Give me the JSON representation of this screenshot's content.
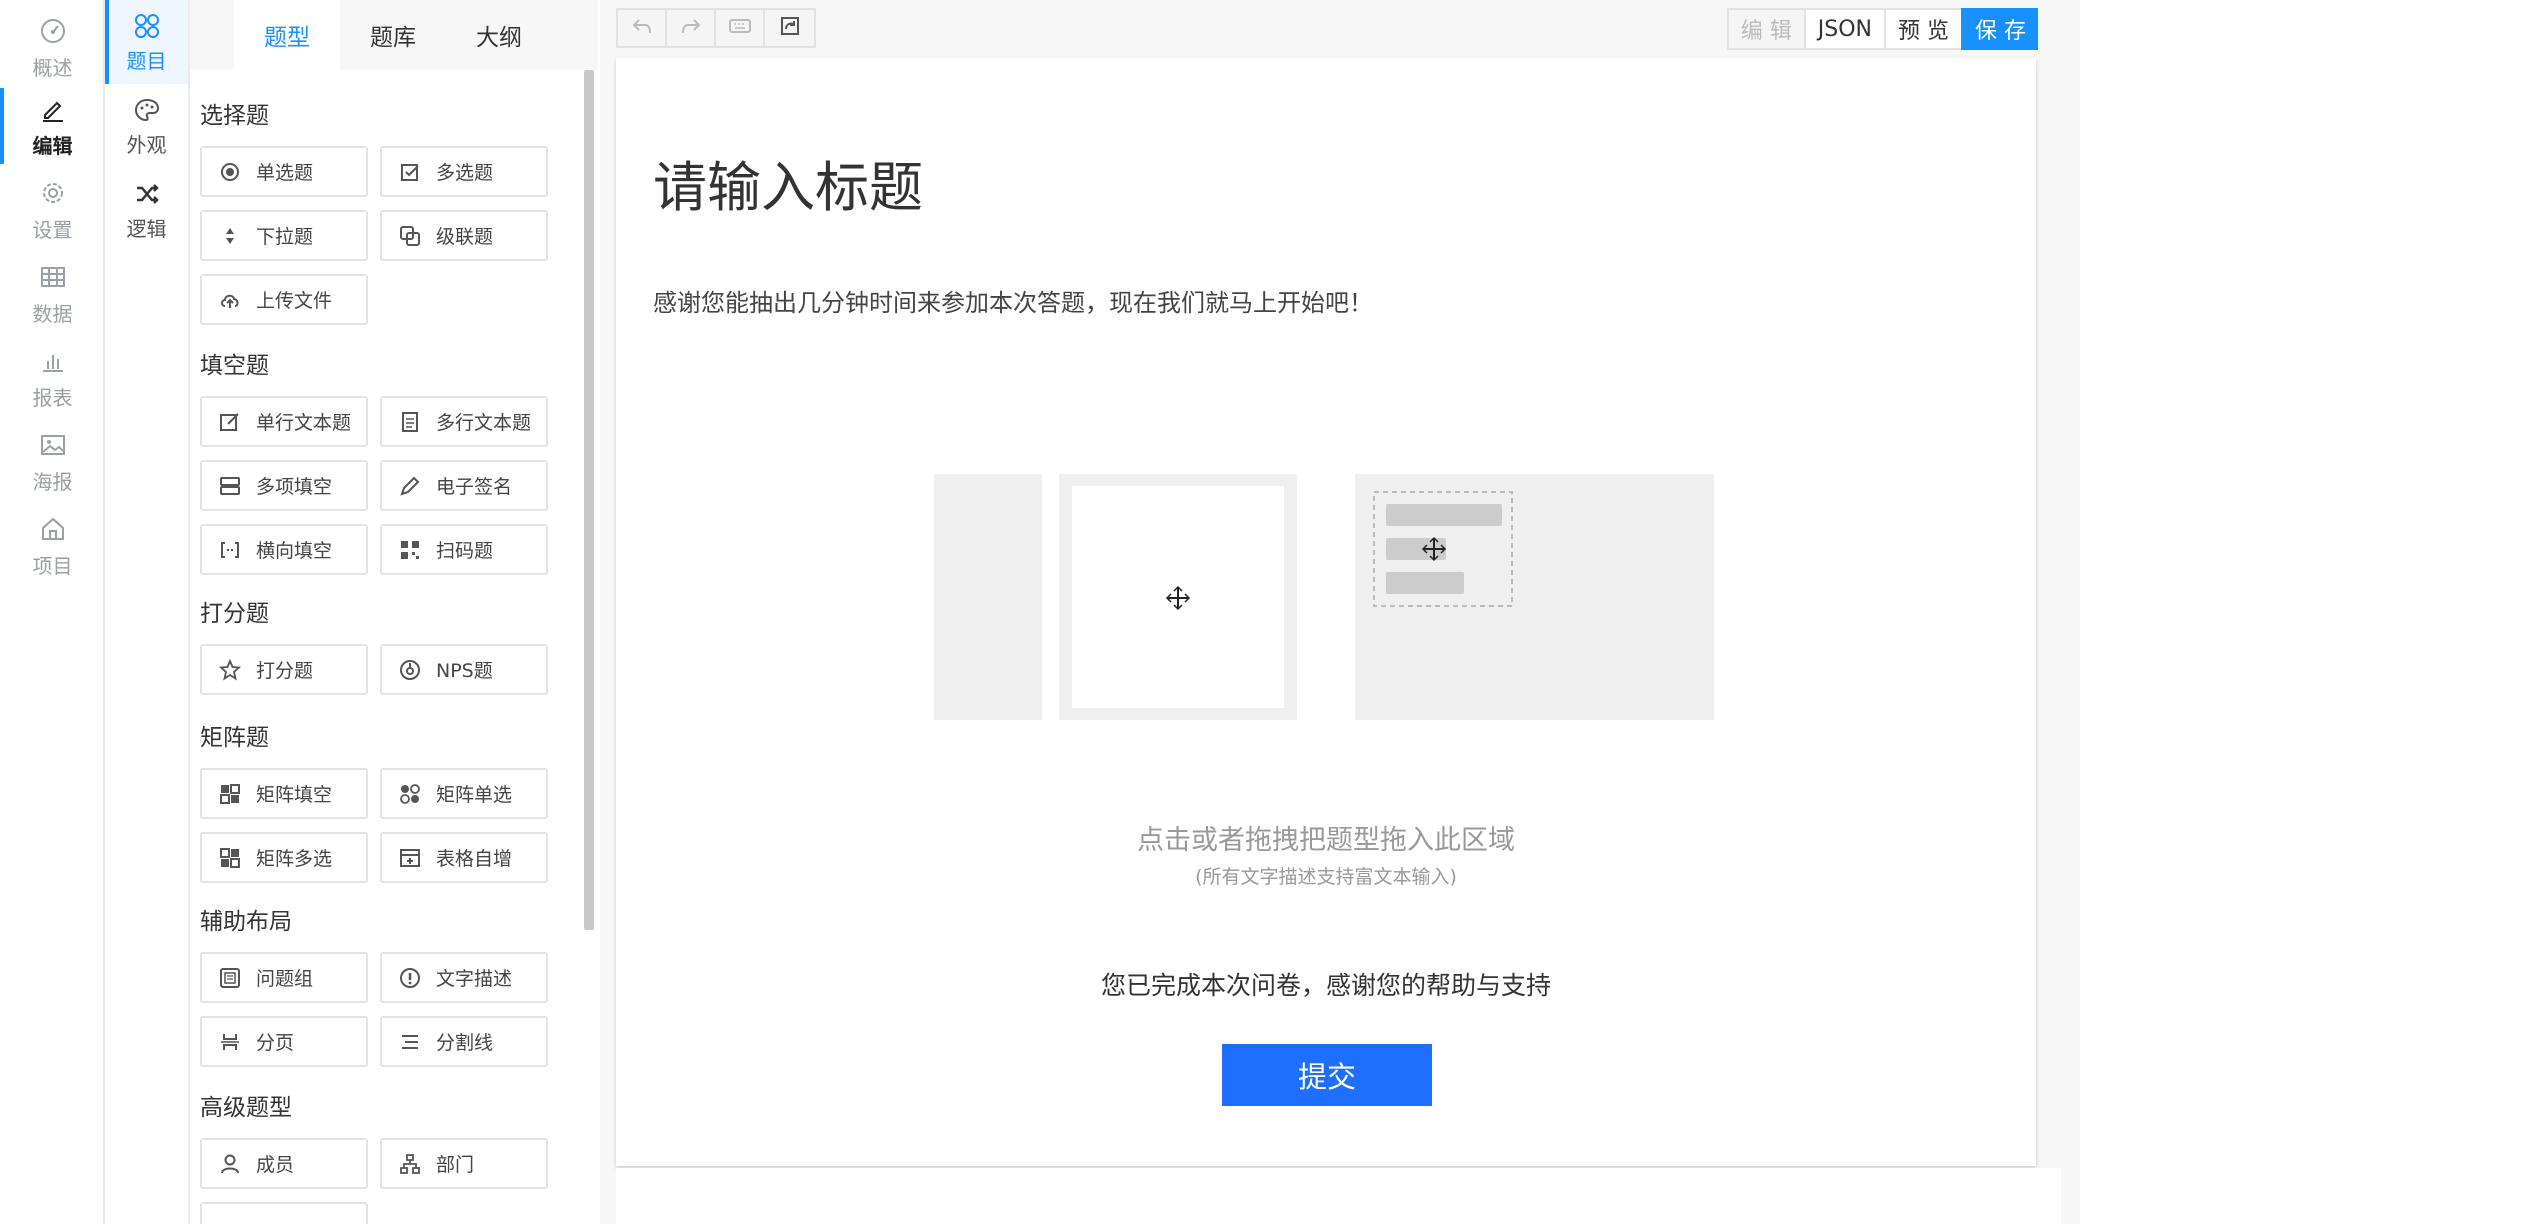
{
  "nav_primary": [
    {
      "label": "概述",
      "icon": "dashboard-icon"
    },
    {
      "label": "编辑",
      "icon": "edit-icon",
      "active": true
    },
    {
      "label": "设置",
      "icon": "gear-icon"
    },
    {
      "label": "数据",
      "icon": "table-icon"
    },
    {
      "label": "报表",
      "icon": "bar-chart-icon"
    },
    {
      "label": "海报",
      "icon": "image-icon"
    },
    {
      "label": "项目",
      "icon": "home-icon"
    }
  ],
  "nav_secondary": [
    {
      "label": "题目",
      "icon": "grid-circles-icon",
      "active": true
    },
    {
      "label": "外观",
      "icon": "palette-icon"
    },
    {
      "label": "逻辑",
      "icon": "shuffle-icon"
    }
  ],
  "panel_tabs": [
    {
      "label": "题型",
      "active": true
    },
    {
      "label": "题库"
    },
    {
      "label": "大纲"
    }
  ],
  "groups": {
    "choice": {
      "title": "选择题",
      "items": [
        "单选题",
        "多选题",
        "下拉题",
        "级联题",
        "上传文件"
      ]
    },
    "fill": {
      "title": "填空题",
      "items": [
        "单行文本题",
        "多行文本题",
        "多项填空",
        "电子签名",
        "横向填空",
        "扫码题"
      ]
    },
    "rating": {
      "title": "打分题",
      "items": [
        "打分题",
        "NPS题"
      ]
    },
    "matrix": {
      "title": "矩阵题",
      "items": [
        "矩阵填空",
        "矩阵单选",
        "矩阵多选",
        "表格自增"
      ]
    },
    "layout": {
      "title": "辅助布局",
      "items": [
        "问题组",
        "文字描述",
        "分页",
        "分割线"
      ]
    },
    "advanced": {
      "title": "高级题型",
      "items": [
        "成员",
        "部门"
      ]
    }
  },
  "toolbar": {
    "edit": "编 辑",
    "json": "JSON",
    "preview": "预 览",
    "save": "保 存"
  },
  "survey": {
    "title": "请输入标题",
    "description": "感谢您能抽出几分钟时间来参加本次答题，现在我们就马上开始吧！",
    "drop_hint": "点击或者拖拽把题型拖入此区域",
    "drop_hint_sub": "(所有文字描述支持富文本输入)",
    "finish": "您已完成本次问卷，感谢您的帮助与支持",
    "submit": "提交"
  },
  "colors": {
    "accent": "#1890ff",
    "submit": "#1e6fff"
  }
}
